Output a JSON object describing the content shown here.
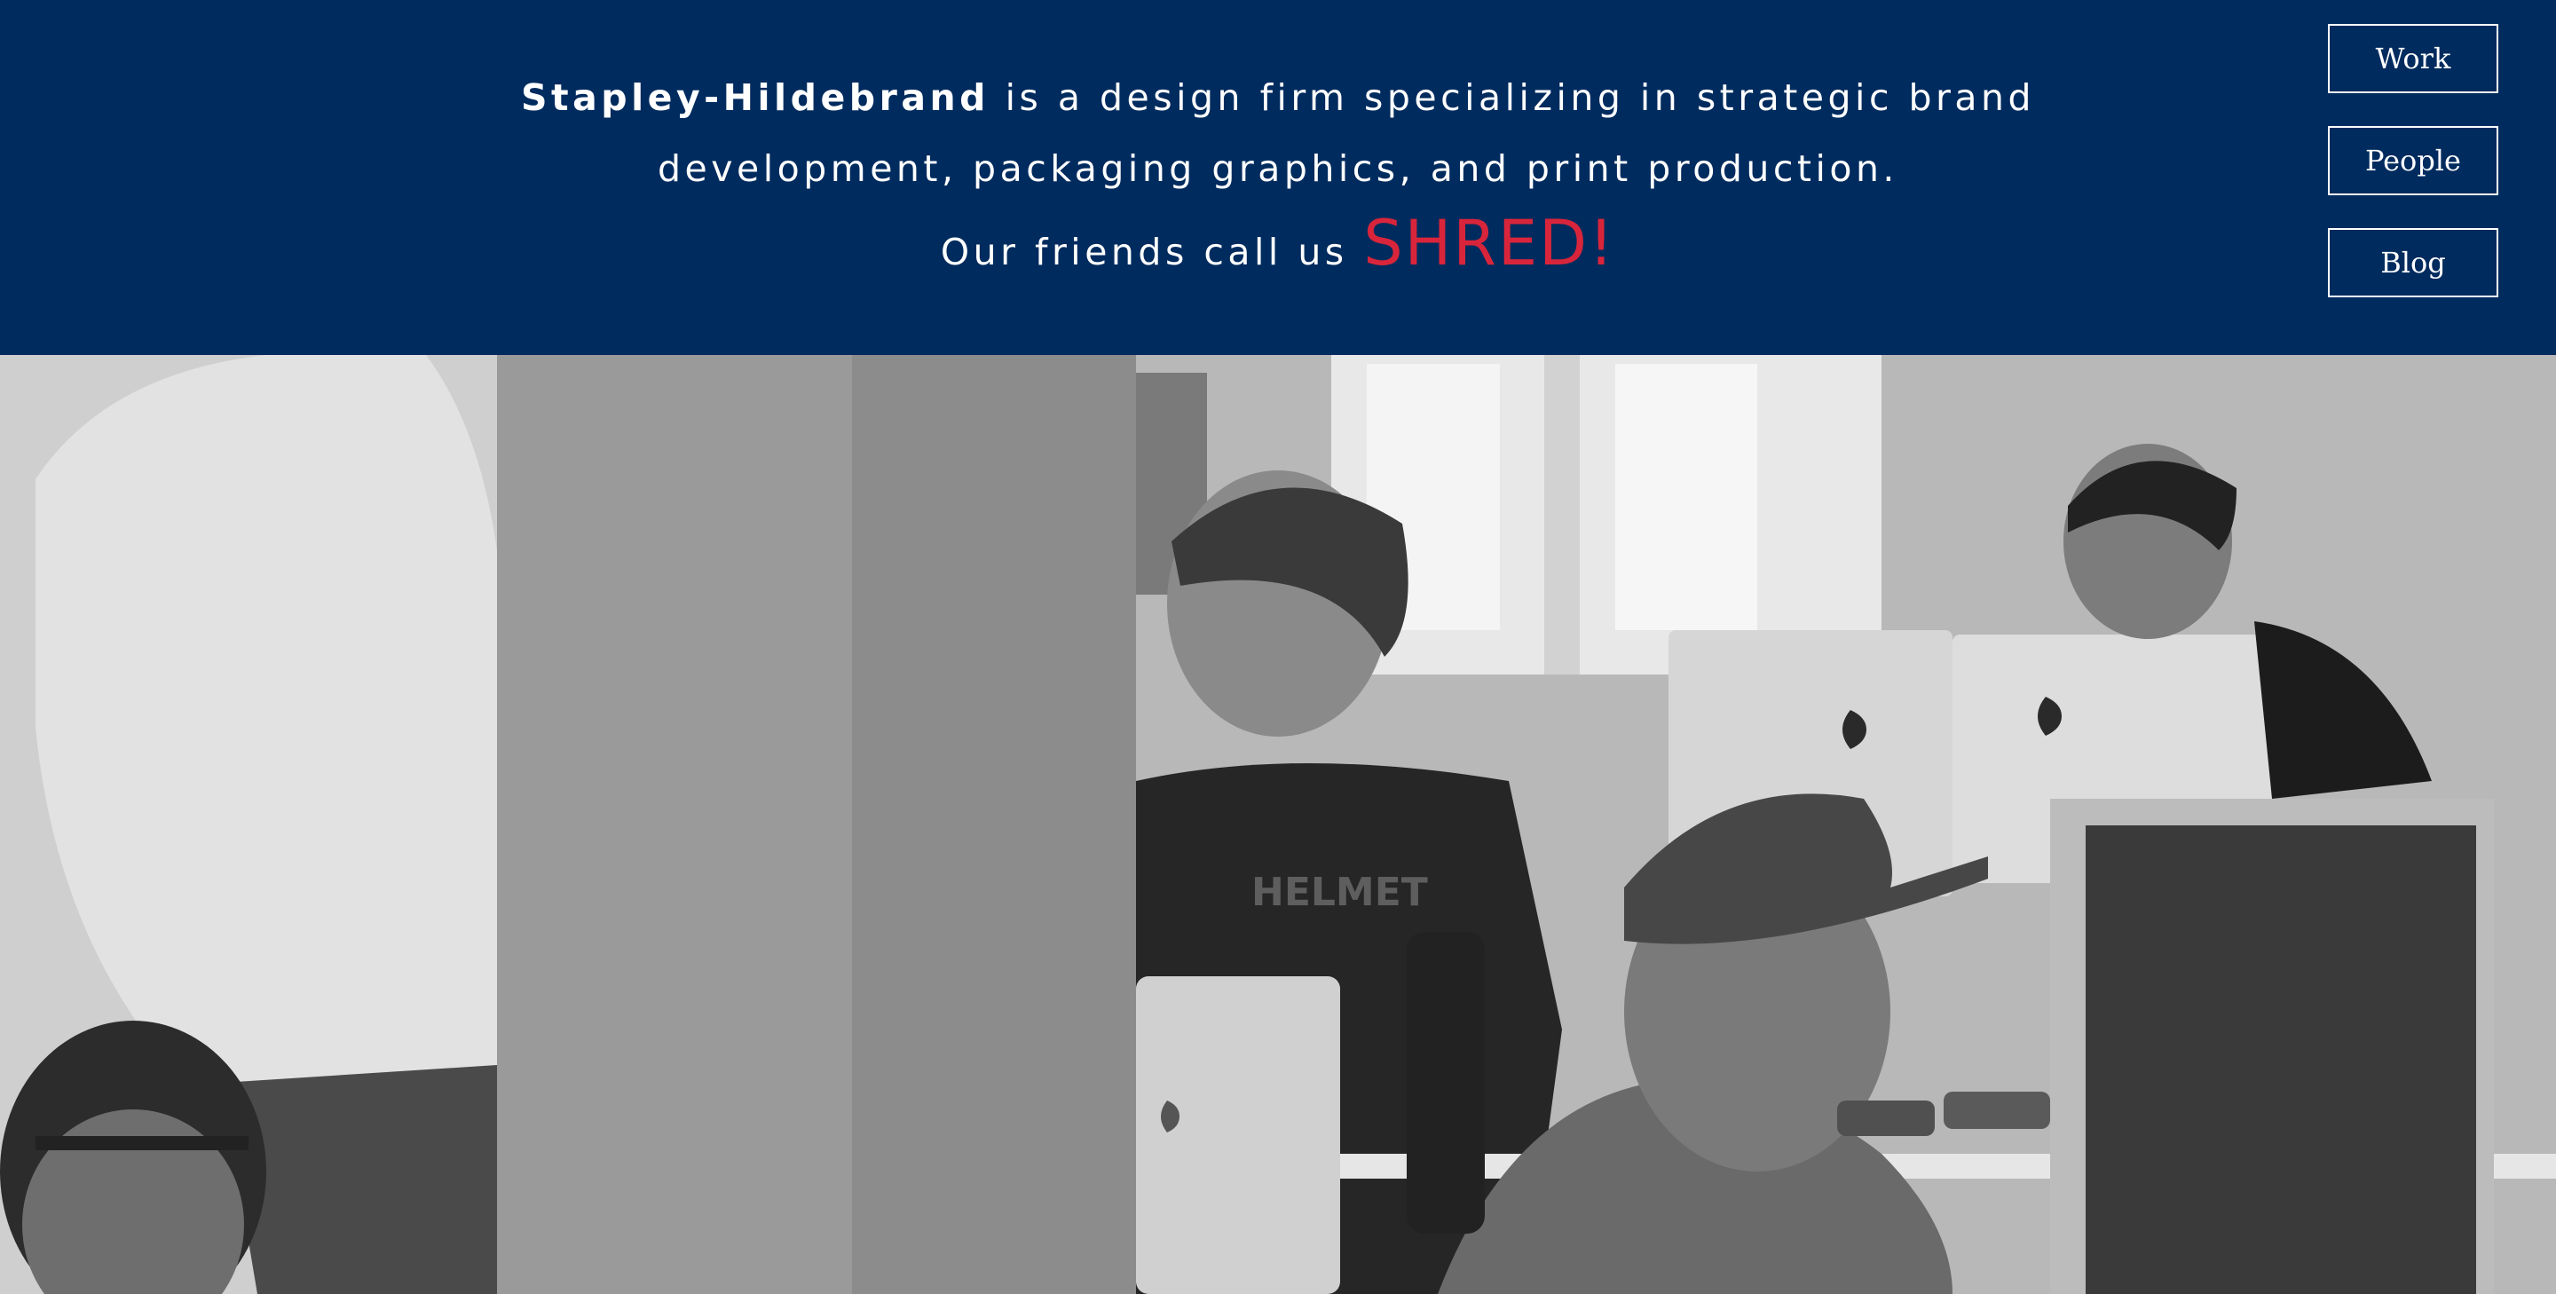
{
  "intro": {
    "firm_name": "Stapley-Hildebrand",
    "line1_rest": " is a design firm specializing in strategic brand",
    "line2": "development, packaging graphics, and print production.",
    "line3_prefix": "Our friends call us ",
    "shred": "SHRED!"
  },
  "nav": {
    "items": [
      {
        "label": "Work"
      },
      {
        "label": "People"
      },
      {
        "label": "Blog"
      }
    ]
  },
  "photo": {
    "shirt_text": "HELMET"
  },
  "colors": {
    "header_bg": "#002b5e",
    "text": "#ffffff",
    "accent": "#d9253b"
  }
}
